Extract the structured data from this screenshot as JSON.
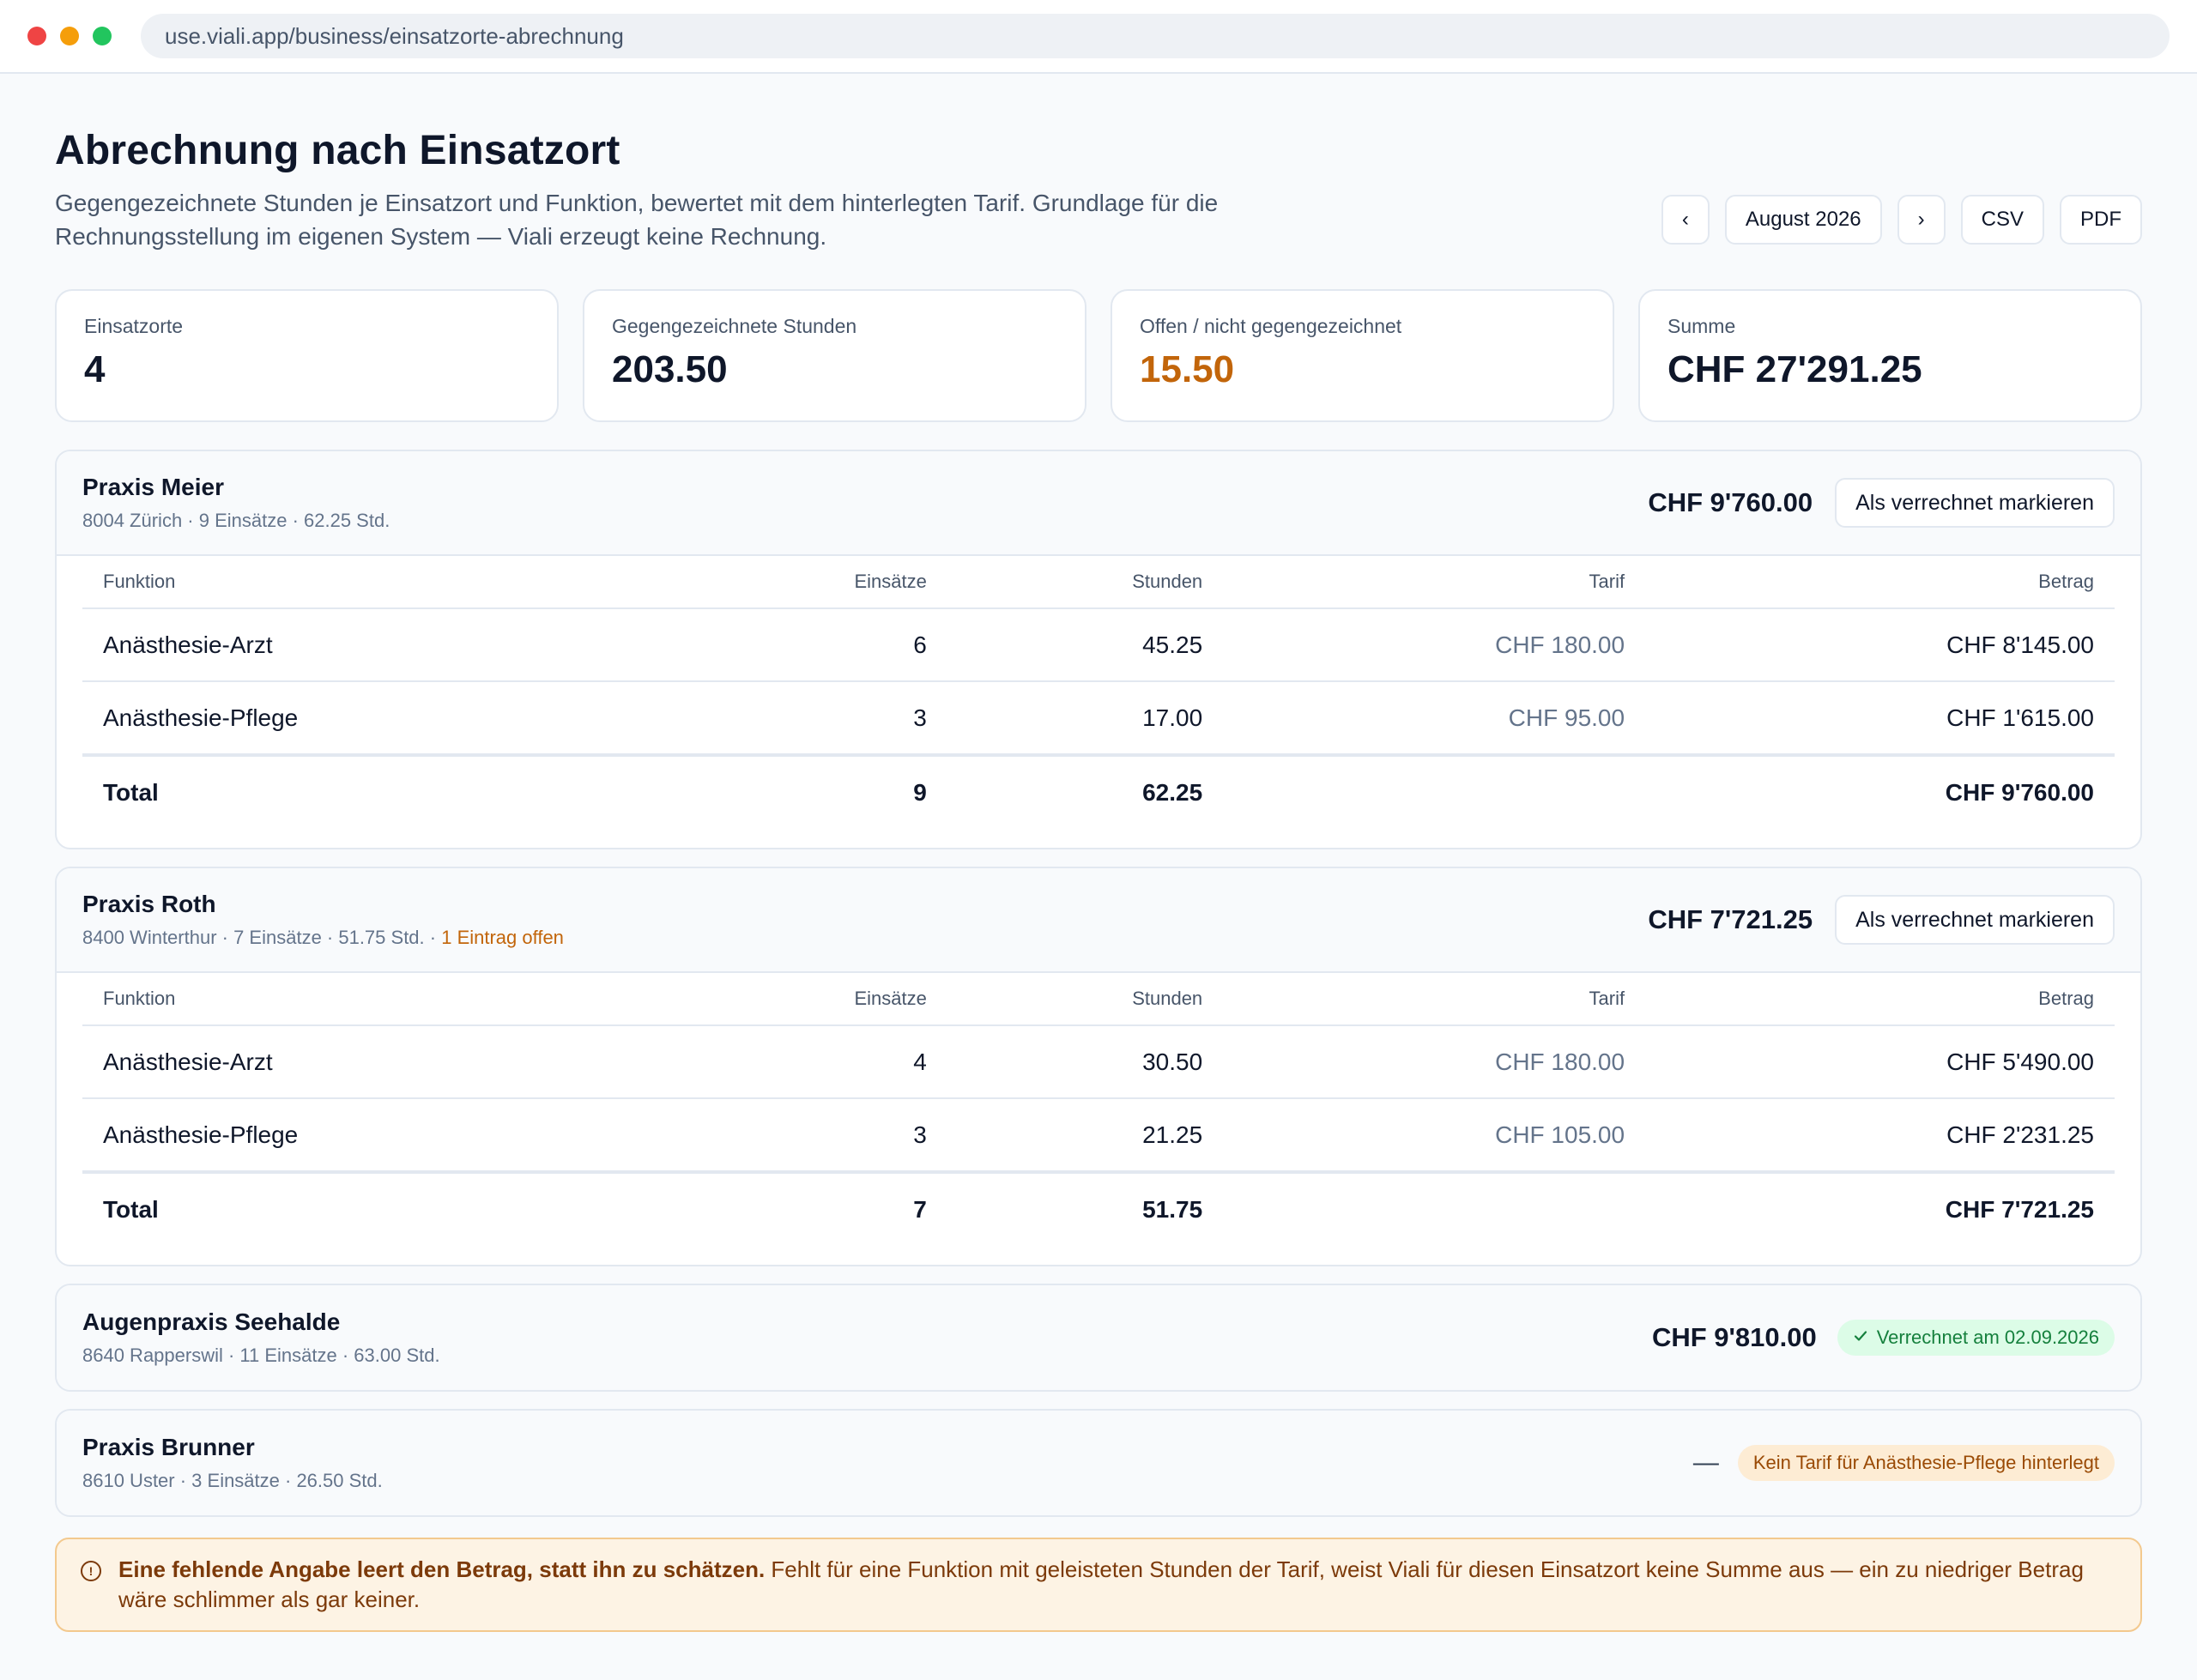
{
  "browser": {
    "url": "use.viali.app/business/einsatzorte-abrechnung",
    "dot_colors": [
      "#ef4444",
      "#f59e0b",
      "#22c55e"
    ]
  },
  "header": {
    "title": "Abrechnung nach Einsatzort",
    "description": "Gegengezeichnete Stunden je Einsatzort und Funktion, bewertet mit dem hinterlegten Tarif. Grundlage für die Rechnungsstellung im eigenen System — Viali erzeugt keine Rechnung.",
    "prev_label": "‹",
    "month_label": "August 2026",
    "next_label": "›",
    "csv_label": "CSV",
    "pdf_label": "PDF"
  },
  "stats": [
    {
      "label": "Einsatzorte",
      "value": "4"
    },
    {
      "label": "Gegengezeichnete Stunden",
      "value": "203.50"
    },
    {
      "label": "Offen / nicht gegengezeichnet",
      "value": "15.50"
    },
    {
      "label": "Summe",
      "value": "CHF 27'291.25"
    }
  ],
  "columns": {
    "funktion": "Funktion",
    "einsaetze": "Einsätze",
    "stunden": "Stunden",
    "tarif": "Tarif",
    "betrag": "Betrag"
  },
  "mark_label": "Als verrechnet markieren",
  "locations": [
    {
      "name": "Praxis Meier",
      "meta": "8004 Zürich · 9 Einsätze · 62.25 Std.",
      "amount": "CHF 9'760.00",
      "rows": [
        {
          "funktion": "Anästhesie-Arzt",
          "einsaetze": "6",
          "stunden": "45.25",
          "tarif": "CHF 180.00",
          "betrag": "CHF 8'145.00"
        },
        {
          "funktion": "Anästhesie-Pflege",
          "einsaetze": "3",
          "stunden": "17.00",
          "tarif": "CHF 95.00",
          "betrag": "CHF 1'615.00"
        }
      ],
      "total": {
        "label": "Total",
        "einsaetze": "9",
        "stunden": "62.25",
        "betrag": "CHF 9'760.00"
      }
    },
    {
      "name": "Praxis Roth",
      "meta": "8400 Winterthur · 7 Einsätze · 51.75 Std. · ",
      "open_note": "1 Eintrag offen",
      "amount": "CHF 7'721.25",
      "rows": [
        {
          "funktion": "Anästhesie-Arzt",
          "einsaetze": "4",
          "stunden": "30.50",
          "tarif": "CHF 180.00",
          "betrag": "CHF 5'490.00"
        },
        {
          "funktion": "Anästhesie-Pflege",
          "einsaetze": "3",
          "stunden": "21.25",
          "tarif": "CHF 105.00",
          "betrag": "CHF 2'231.25"
        }
      ],
      "total": {
        "label": "Total",
        "einsaetze": "7",
        "stunden": "51.75",
        "betrag": "CHF 7'721.25"
      }
    },
    {
      "name": "Augenpraxis Seehalde",
      "meta": "8640 Rapperswil · 11 Einsätze · 63.00 Std.",
      "amount": "CHF 9'810.00",
      "badge": "Verrechnet am 02.09.2026"
    },
    {
      "name": "Praxis Brunner",
      "meta": "8610 Uster · 3 Einsätze · 26.50 Std.",
      "amount": "—",
      "warning": "Kein Tarif für Anästhesie-Pflege hinterlegt"
    }
  ],
  "note": {
    "bold": "Eine fehlende Angabe leert den Betrag, statt ihn zu schätzen.",
    "text": " Fehlt für eine Funktion mit geleisteten Stunden der Tarif, weist Viali für diesen Einsatzort keine Summe aus — ein zu niedriger Betrag wäre schlimmer als gar keiner."
  }
}
